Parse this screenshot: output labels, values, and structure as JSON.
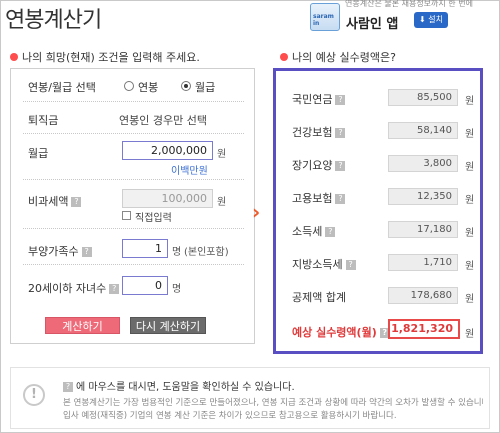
{
  "header": {
    "title": "연봉계산기",
    "promo": {
      "logo_text": "saram in",
      "tagline": "연봉계산은 물론 채용정보까지 한 번에",
      "app_name": "사람인 앱",
      "install_label": "설치",
      "install_icon": "download-icon"
    }
  },
  "input_section": {
    "heading": "나의 희망(현재) 조건을 입력해 주세요.",
    "salary_type": {
      "label": "연봉/월급 선택",
      "options": [
        "연봉",
        "월급"
      ],
      "selected": "월급"
    },
    "severance": {
      "label": "퇴직금",
      "text": "연봉인 경우만 선택"
    },
    "monthly_pay": {
      "label": "월급",
      "value": "2,000,000",
      "unit": "원",
      "hint": "이백만원"
    },
    "non_taxable": {
      "label": "비과세액",
      "value": "100,000",
      "unit": "원",
      "checkbox_label": "직접입력"
    },
    "dependents": {
      "label": "부양가족수",
      "value": "1",
      "unit": "명",
      "note": "(본인포함)"
    },
    "children_under_20": {
      "label": "20세이하 자녀수",
      "value": "0",
      "unit": "명"
    },
    "buttons": {
      "calculate": "계산하기",
      "reset": "다시 계산하기"
    }
  },
  "result_section": {
    "heading": "나의 예상 실수령액은?",
    "rows": [
      {
        "label": "국민연금",
        "value": "85,500",
        "unit": "원"
      },
      {
        "label": "건강보험",
        "value": "58,140",
        "unit": "원"
      },
      {
        "label": "장기요양",
        "value": "3,800",
        "unit": "원"
      },
      {
        "label": "고용보험",
        "value": "12,350",
        "unit": "원"
      },
      {
        "label": "소득세",
        "value": "17,180",
        "unit": "원"
      },
      {
        "label": "지방소득세",
        "value": "1,710",
        "unit": "원"
      },
      {
        "label": "공제액 합계",
        "value": "178,680",
        "unit": "원"
      }
    ],
    "net_pay": {
      "label": "예상 실수령액(월)",
      "value": "1,821,320",
      "unit": "원"
    }
  },
  "notice": {
    "head": "에 마우스를 대시면, 도움말을 확인하실 수 있습니다.",
    "lines": [
      "본 연봉계산기는 가장 범용적인 기준으로 만들어졌으나, 연봉 지급 조건과 상황에 따라 약간의 오차가 발생할 수 있습니다.",
      "입사 예정(재직중) 기업의 연봉 계산 기준은 차이가 있으므로 참고용으로 활용하시기 바랍니다."
    ]
  },
  "colors": {
    "accent_red": "#e03a3a",
    "panel_border_purple": "#5a4fc2",
    "arrow_orange": "#f05a2a",
    "install_blue": "#2a68c8",
    "calculate_pink": "#ee6a78",
    "reset_gray": "#6b6b6b"
  }
}
